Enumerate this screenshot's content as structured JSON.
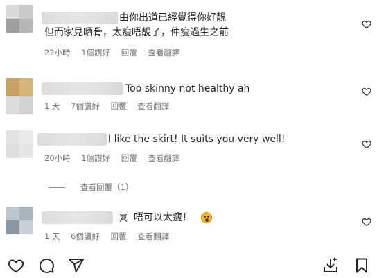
{
  "comments": [
    {
      "line1": "由你出道已經覺得你好靚",
      "line2": "但而家見晒骨，太瘦唔靚了，仲瘦過生之前",
      "time": "22小時",
      "likes": "1個讚好",
      "reply": "回覆",
      "translate": "查看翻譯"
    },
    {
      "line1": "Too skinny not healthy ah",
      "time": "1 天",
      "likes": "7個讚好",
      "reply": "回覆",
      "translate": "查看翻譯"
    },
    {
      "line1": "I like the skirt! It suits you very well!",
      "time": "20小時",
      "likes": "1個讚好",
      "reply": "回覆",
      "translate": "查看翻譯",
      "view_replies": "查看回覆（1）"
    },
    {
      "line1": "唔可以太瘦！",
      "time": "1 天",
      "likes": "6個讚好",
      "reply": "回覆",
      "translate": "查看翻譯"
    }
  ],
  "colors": {
    "text": "#262626",
    "meta": "#737373",
    "icon": "#262626"
  },
  "icons": {
    "like": "heart-outline-icon",
    "comment": "comment-icon",
    "share": "send-icon",
    "download": "download-icon",
    "save": "bookmark-icon"
  }
}
